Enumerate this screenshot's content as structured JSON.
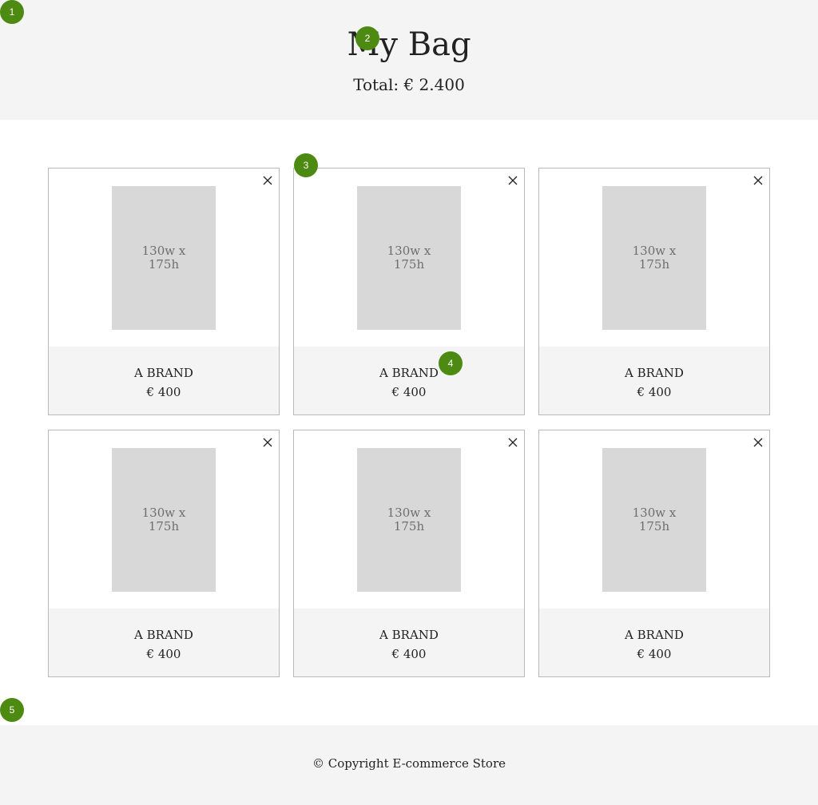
{
  "header": {
    "title": "My Bag",
    "total": "Total: € 2.400"
  },
  "products": [
    {
      "brand": "A BRAND",
      "price": "€ 400",
      "image_placeholder_line1": "130w x",
      "image_placeholder_line2": "175h"
    },
    {
      "brand": "A BRAND",
      "price": "€ 400",
      "image_placeholder_line1": "130w x",
      "image_placeholder_line2": "175h"
    },
    {
      "brand": "A BRAND",
      "price": "€ 400",
      "image_placeholder_line1": "130w x",
      "image_placeholder_line2": "175h"
    },
    {
      "brand": "A BRAND",
      "price": "€ 400",
      "image_placeholder_line1": "130w x",
      "image_placeholder_line2": "175h"
    },
    {
      "brand": "A BRAND",
      "price": "€ 400",
      "image_placeholder_line1": "130w x",
      "image_placeholder_line2": "175h"
    },
    {
      "brand": "A BRAND",
      "price": "€ 400",
      "image_placeholder_line1": "130w x",
      "image_placeholder_line2": "175h"
    }
  ],
  "footer": {
    "copyright": "© Copyright E-commerce Store"
  },
  "markers": [
    "1",
    "2",
    "3",
    "4",
    "5"
  ],
  "icons": {
    "remove": "close-icon"
  },
  "colors": {
    "marker_green": "#4d8a12",
    "section_bg": "#f4f4f4",
    "placeholder_bg": "#d8d8d8"
  }
}
